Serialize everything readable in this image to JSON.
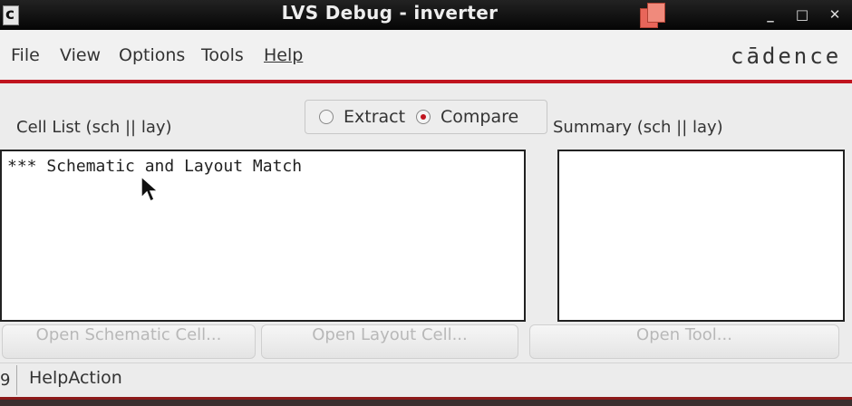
{
  "window": {
    "title": "LVS Debug - inverter",
    "app_icon_letter": "c",
    "minimize_label": "_",
    "maximize_label": "□",
    "close_label": "✕"
  },
  "menu": {
    "file": "File",
    "view": "View",
    "options": "Options",
    "tools": "Tools",
    "help": "Help"
  },
  "brand": {
    "logo_text": "cādence",
    "accent_color": "#c0141e"
  },
  "mode": {
    "extract_label": "Extract",
    "compare_label": "Compare",
    "selected": "Compare"
  },
  "cell_list": {
    "label": "Cell List (sch || lay)",
    "lines": [
      "*** Schematic and Layout Match"
    ]
  },
  "summary": {
    "label": "Summary (sch || lay)"
  },
  "buttons": {
    "open_schematic": "Open Schematic Cell...",
    "open_layout": "Open Layout Cell...",
    "open_tool": "Open Tool..."
  },
  "status": {
    "left_cell": "9",
    "text": "HelpAction"
  }
}
